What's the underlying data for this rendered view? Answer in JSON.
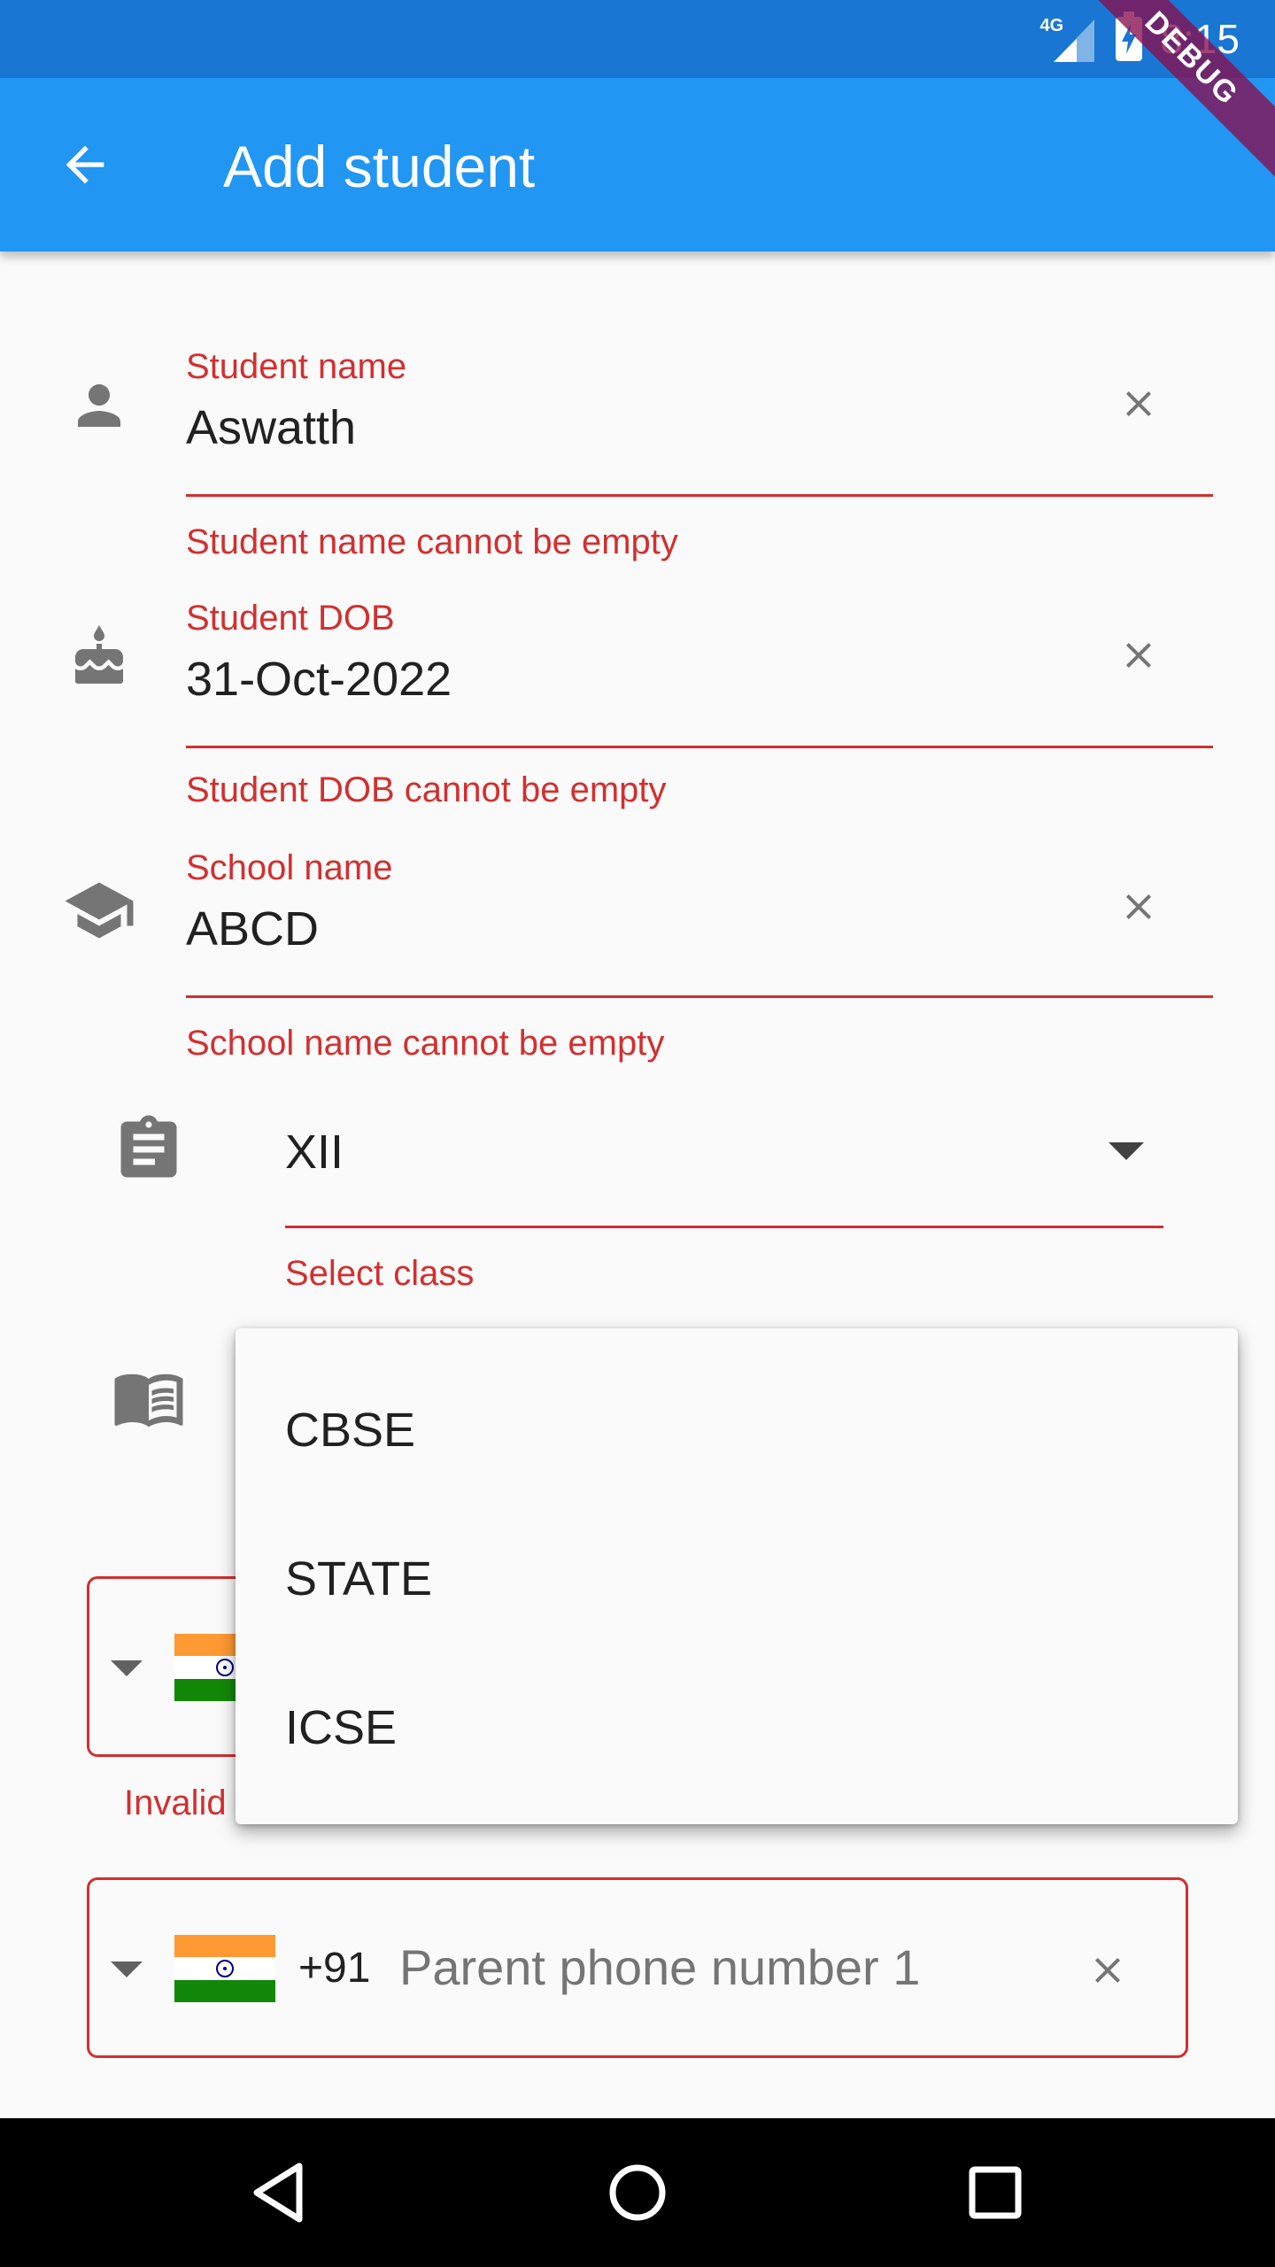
{
  "status_bar": {
    "network": "4G",
    "time": "8:15",
    "debug_banner": "DEBUG"
  },
  "app_bar": {
    "title": "Add student",
    "back_icon": "arrow-back-icon"
  },
  "form": {
    "student_name": {
      "label": "Student name",
      "value": "Aswatth",
      "error": "Student name cannot be empty",
      "icon": "person-icon"
    },
    "student_dob": {
      "label": "Student DOB",
      "value": "31-Oct-2022",
      "error": "Student DOB cannot be empty",
      "icon": "cake-icon"
    },
    "school_name": {
      "label": "School name",
      "value": "ABCD",
      "error": "School name cannot be empty",
      "icon": "school-icon"
    },
    "class_select": {
      "value": "XII",
      "error": "Select class",
      "icon": "assignment-icon"
    },
    "board_select": {
      "icon": "menu-book-icon",
      "options": [
        "CBSE",
        "STATE",
        "ICSE"
      ]
    },
    "phone_1": {
      "error_partial": "Invalid"
    },
    "parent_phone_1": {
      "dial_code": "+91",
      "placeholder": "Parent phone number 1"
    }
  },
  "colors": {
    "status_bar": "#1976d2",
    "app_bar": "#2196f3",
    "error": "#d32f2f",
    "background": "#fafafa"
  }
}
